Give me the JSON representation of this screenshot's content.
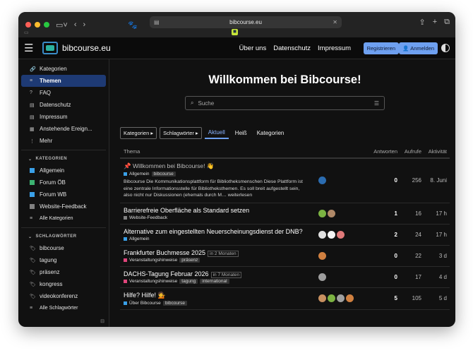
{
  "browser": {
    "url": "bibcourse.eu"
  },
  "header": {
    "brand": "bibcourse.eu",
    "nav": [
      "Über uns",
      "Datenschutz",
      "Impressum"
    ],
    "register": "Registrieren",
    "login": "Anmelden"
  },
  "sidebar": {
    "items": [
      {
        "label": "Kategorien",
        "icon": "link-icon"
      },
      {
        "label": "Themen",
        "icon": "layers-icon",
        "active": true
      },
      {
        "label": "FAQ",
        "icon": "question-icon"
      },
      {
        "label": "Datenschutz",
        "icon": "doc-icon"
      },
      {
        "label": "Impressum",
        "icon": "doc-icon"
      },
      {
        "label": "Anstehende Ereign...",
        "icon": "calendar-icon"
      },
      {
        "label": "Mehr",
        "icon": "more-icon"
      }
    ],
    "categories_title": "KATEGORIEN",
    "categories": [
      {
        "label": "Allgemein",
        "color": "#3aa0e8"
      },
      {
        "label": "Forum ÖB",
        "color": "#3cb371"
      },
      {
        "label": "Forum WB",
        "color": "#3aa0e8"
      },
      {
        "label": "Website-Feedback",
        "color": "#808080"
      }
    ],
    "all_categories": "Alle Kategorien",
    "tags_title": "SCHLAGWÖRTER",
    "tags": [
      "bibcourse",
      "tagung",
      "präsenz",
      "kongress",
      "videokonferenz"
    ],
    "all_tags": "Alle Schlagwörter"
  },
  "main": {
    "welcome": "Willkommen bei Bibcourse!",
    "search_placeholder": "Suche",
    "filters": {
      "categories": "Kategorien",
      "tags": "Schlagwörter"
    },
    "tabs": [
      "Aktuell",
      "Heiß",
      "Kategorien"
    ],
    "columns": {
      "topic": "Thema",
      "replies": "Antworten",
      "views": "Aufrufe",
      "activity": "Aktivität"
    },
    "topics": [
      {
        "title": "Willkommen bei Bibcourse! 👋",
        "pinned": true,
        "category": "Allgemein",
        "category_color": "#3aa0e8",
        "tags": [
          "bibcourse"
        ],
        "excerpt": "Bibcourse Die Kommunikationsplattform für Bibliotheksmenschen Diese Plattform ist eine zentrale Informationsstelle für Bibliotheksthemen. Es soll breit aufgestellt sein, also nicht nur Diskussionen (ehemals durch M…",
        "read_more": "weiterlesen",
        "avatars": [
          "#2b6cb0"
        ],
        "replies": "0",
        "views": "256",
        "activity": "8. Juni"
      },
      {
        "title": "Barrierefreie Oberfläche als Standard setzen",
        "category": "Website-Feedback",
        "category_color": "#808080",
        "tags": [],
        "avatars": [
          "#7cb342",
          "#b08968"
        ],
        "replies": "1",
        "views": "16",
        "activity": "17 h"
      },
      {
        "title": "Alternative zum eingestellten Neuerscheinungsdienst der DNB?",
        "category": "Allgemein",
        "category_color": "#3aa0e8",
        "tags": [],
        "avatars": [
          "#e0e0e0",
          "#f5f5f5",
          "#e07a7a"
        ],
        "replies": "2",
        "views": "24",
        "activity": "17 h"
      },
      {
        "title": "Frankfurter Buchmesse 2025",
        "status": "in 2 Monaten",
        "category": "Veranstaltungshinweise",
        "category_color": "#e0457b",
        "tags": [
          "präsenz"
        ],
        "avatars": [
          "#d08040"
        ],
        "replies": "0",
        "views": "22",
        "activity": "3 d"
      },
      {
        "title": "DACHS-Tagung Februar 2026",
        "status": "in 7 Monaten",
        "category": "Veranstaltungshinweise",
        "category_color": "#e0457b",
        "tags": [
          "tagung",
          "international"
        ],
        "avatars": [
          "#9e9e9e"
        ],
        "replies": "0",
        "views": "17",
        "activity": "4 d"
      },
      {
        "title": "Hilfe? Hilfe! 💁",
        "category": "Über Bibcourse",
        "category_color": "#3aa0e8",
        "tags": [
          "bibcourse"
        ],
        "avatars": [
          "#c89060",
          "#7cb342",
          "#a0a0a0",
          "#d08040"
        ],
        "replies": "5",
        "views": "105",
        "activity": "5 d"
      }
    ]
  }
}
